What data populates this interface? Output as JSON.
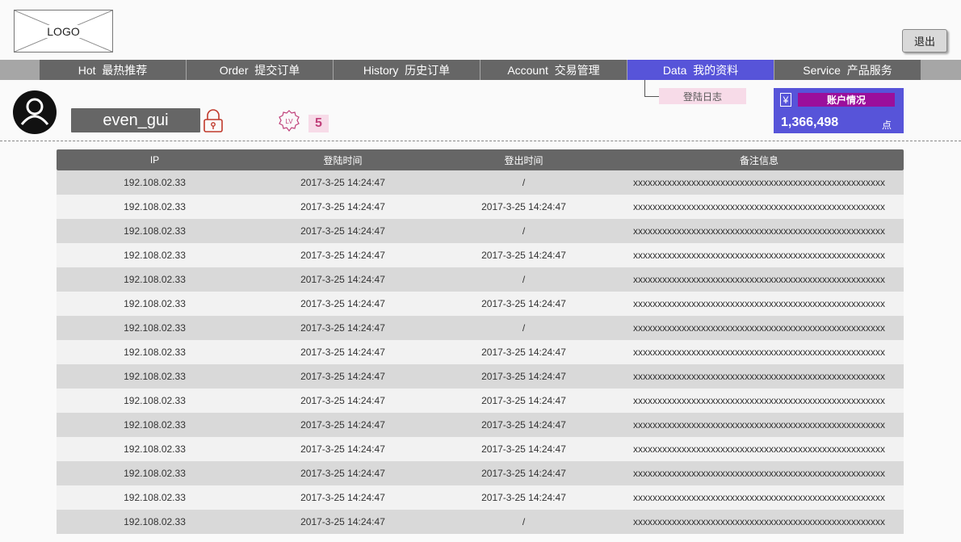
{
  "header": {
    "logo_text": "LOGO",
    "logout_label": "退出"
  },
  "nav": {
    "items": [
      {
        "label": "Hot  最热推荐",
        "active": false
      },
      {
        "label": "Order  提交订单",
        "active": false
      },
      {
        "label": "History  历史订单",
        "active": false
      },
      {
        "label": "Account  交易管理",
        "active": false
      },
      {
        "label": "Data  我的资料",
        "active": true
      },
      {
        "label": "Service  产品服务",
        "active": false
      }
    ],
    "submenu_label": "登陆日志"
  },
  "profile": {
    "username": "even_gui",
    "level_badge": "LV",
    "level": "5"
  },
  "account": {
    "currency_symbol": "¥",
    "label": "账户情况",
    "amount": "1,366,498",
    "unit": "点"
  },
  "colors": {
    "accent": "#5754d9",
    "nav_bg": "#666666",
    "badge_purple": "#9b0f9b",
    "pink": "#f7dbe8"
  },
  "table": {
    "headers": [
      "IP",
      "登陆时间",
      "登出时间",
      "备注信息"
    ],
    "rows": [
      [
        "192.108.02.33",
        "2017-3-25 14:24:47",
        "/",
        "xxxxxxxxxxxxxxxxxxxxxxxxxxxxxxxxxxxxxxxxxxxxxxxxxxxx"
      ],
      [
        "192.108.02.33",
        "2017-3-25 14:24:47",
        "2017-3-25 14:24:47",
        "xxxxxxxxxxxxxxxxxxxxxxxxxxxxxxxxxxxxxxxxxxxxxxxxxxxx"
      ],
      [
        "192.108.02.33",
        "2017-3-25 14:24:47",
        "/",
        "xxxxxxxxxxxxxxxxxxxxxxxxxxxxxxxxxxxxxxxxxxxxxxxxxxxx"
      ],
      [
        "192.108.02.33",
        "2017-3-25 14:24:47",
        "2017-3-25 14:24:47",
        "xxxxxxxxxxxxxxxxxxxxxxxxxxxxxxxxxxxxxxxxxxxxxxxxxxxx"
      ],
      [
        "192.108.02.33",
        "2017-3-25 14:24:47",
        "/",
        "xxxxxxxxxxxxxxxxxxxxxxxxxxxxxxxxxxxxxxxxxxxxxxxxxxxx"
      ],
      [
        "192.108.02.33",
        "2017-3-25 14:24:47",
        "2017-3-25 14:24:47",
        "xxxxxxxxxxxxxxxxxxxxxxxxxxxxxxxxxxxxxxxxxxxxxxxxxxxx"
      ],
      [
        "192.108.02.33",
        "2017-3-25 14:24:47",
        "/",
        "xxxxxxxxxxxxxxxxxxxxxxxxxxxxxxxxxxxxxxxxxxxxxxxxxxxx"
      ],
      [
        "192.108.02.33",
        "2017-3-25 14:24:47",
        "2017-3-25 14:24:47",
        "xxxxxxxxxxxxxxxxxxxxxxxxxxxxxxxxxxxxxxxxxxxxxxxxxxxx"
      ],
      [
        "192.108.02.33",
        "2017-3-25 14:24:47",
        "2017-3-25 14:24:47",
        "xxxxxxxxxxxxxxxxxxxxxxxxxxxxxxxxxxxxxxxxxxxxxxxxxxxx"
      ],
      [
        "192.108.02.33",
        "2017-3-25 14:24:47",
        "2017-3-25 14:24:47",
        "xxxxxxxxxxxxxxxxxxxxxxxxxxxxxxxxxxxxxxxxxxxxxxxxxxxx"
      ],
      [
        "192.108.02.33",
        "2017-3-25 14:24:47",
        "2017-3-25 14:24:47",
        "xxxxxxxxxxxxxxxxxxxxxxxxxxxxxxxxxxxxxxxxxxxxxxxxxxxx"
      ],
      [
        "192.108.02.33",
        "2017-3-25 14:24:47",
        "2017-3-25 14:24:47",
        "xxxxxxxxxxxxxxxxxxxxxxxxxxxxxxxxxxxxxxxxxxxxxxxxxxxx"
      ],
      [
        "192.108.02.33",
        "2017-3-25 14:24:47",
        "2017-3-25 14:24:47",
        "xxxxxxxxxxxxxxxxxxxxxxxxxxxxxxxxxxxxxxxxxxxxxxxxxxxx"
      ],
      [
        "192.108.02.33",
        "2017-3-25 14:24:47",
        "2017-3-25 14:24:47",
        "xxxxxxxxxxxxxxxxxxxxxxxxxxxxxxxxxxxxxxxxxxxxxxxxxxxx"
      ],
      [
        "192.108.02.33",
        "2017-3-25 14:24:47",
        "/",
        "xxxxxxxxxxxxxxxxxxxxxxxxxxxxxxxxxxxxxxxxxxxxxxxxxxxx"
      ]
    ]
  }
}
